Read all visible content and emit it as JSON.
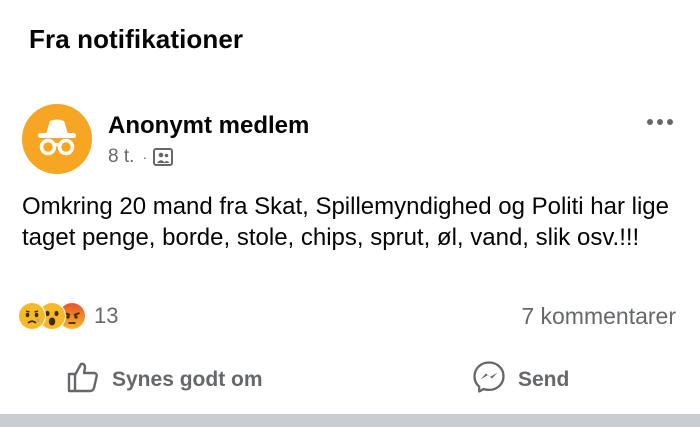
{
  "header": {
    "title": "Fra notifikationer"
  },
  "post": {
    "author": "Anonymt medlem",
    "time": "8 t.",
    "separator": "·",
    "audience_icon": "group-audience-icon",
    "avatar_icon": "incognito-icon",
    "avatar_color": "#f6a623",
    "text": "Omkring 20 mand fra Skat, Spillemyndighed og Politi har lige taget penge, borde, stole, chips, sprut, øl, vand, slik osv.!!!"
  },
  "reactions": {
    "types": [
      "sad",
      "wow",
      "angry"
    ],
    "count": "13"
  },
  "comments": {
    "label": "7 kommentarer"
  },
  "actions": {
    "like_label": "Synes godt om",
    "send_label": "Send"
  },
  "colors": {
    "secondary_text": "#65676b",
    "primary_text": "#050505",
    "divider": "#c9ccd1"
  }
}
